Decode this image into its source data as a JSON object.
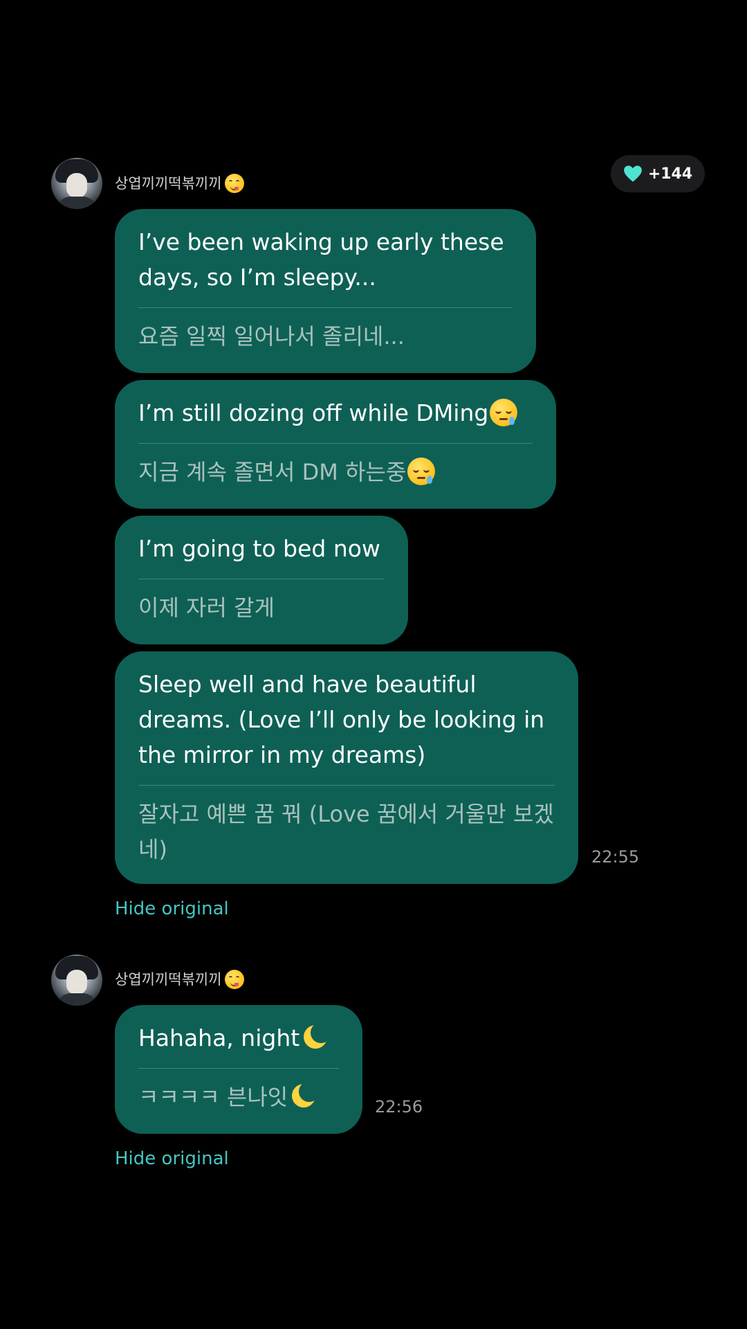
{
  "reactions": {
    "count": "+144",
    "icon": "heart-icon",
    "color": "#4fe3d2"
  },
  "colors": {
    "bubble": "#0e6055",
    "link": "#45c6c3",
    "background": "#000000"
  },
  "groups": [
    {
      "sender": "상엽끼끼떡볶끼끼",
      "sender_emoji": "yum-face-icon",
      "messages": [
        {
          "en": "I’ve been waking up early these days, so I’m sleepy...",
          "ko": "요즘 일찍 일어나서 졸리네..."
        },
        {
          "en": "I’m still dozing off while DMing",
          "ko": "지금 계속 졸면서 DM 하는중",
          "emoji": "sleepy-face-icon"
        },
        {
          "en": "I’m going to bed now",
          "ko": "이제 자러 갈게"
        },
        {
          "en": "Sleep well and have beautiful dreams. (Love I’ll only be looking in the mirror in my dreams)",
          "ko": "잘자고 예쁜 꿈 꿔 (Love 꿈에서 거울만 보겠네)"
        }
      ],
      "time": "22:55",
      "hide_label": "Hide original"
    },
    {
      "sender": "상엽끼끼떡볶끼끼",
      "sender_emoji": "yum-face-icon",
      "messages": [
        {
          "en": "Hahaha, night",
          "ko": "ㅋㅋㅋㅋ 븐나잇",
          "emoji": "crescent-moon-icon"
        }
      ],
      "time": "22:56",
      "hide_label": "Hide original"
    }
  ]
}
